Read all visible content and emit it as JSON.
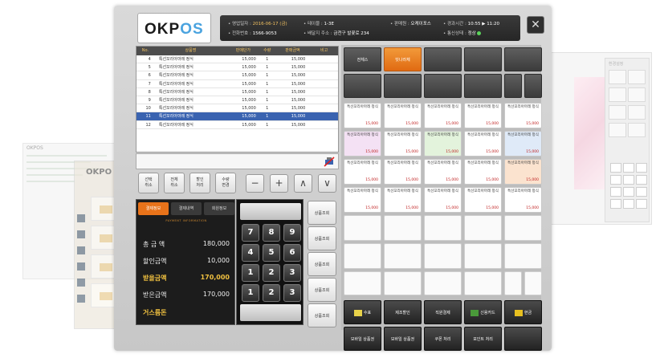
{
  "app": {
    "logo_main": "OKP",
    "logo_accent": "OS",
    "ghost_left_title": "OKPOS",
    "ghost_left2_logo": "OKPO",
    "ghost_right_title": "환경설정"
  },
  "info_bar": {
    "items": [
      {
        "label": "• 영업일자 :",
        "value": "2016-06-17 (금)"
      },
      {
        "label": "• 전화번호 :",
        "value": "1566-9053"
      },
      {
        "label": "• 테이블 :",
        "value": "1-3E"
      },
      {
        "label": "• 배달지 주소 :",
        "value": "금천구 발꽃로 234"
      },
      {
        "label": "• 판매원 :",
        "value": "오케이포스"
      },
      {
        "label": "• 경과시간 :",
        "value": "10:55"
      },
      {
        "label": "",
        "value": "11:20"
      },
      {
        "label": "• 통신상태 :",
        "value": "정상"
      }
    ]
  },
  "order_table": {
    "headers": [
      "No.",
      "상품명",
      "판매단가",
      "수량",
      "판매금액",
      "비고"
    ],
    "rows": [
      [
        "4",
        "특선꼬리아마레 정식",
        "15,000",
        "1",
        "15,000",
        ""
      ],
      [
        "5",
        "특선꼬리아마레 정식",
        "15,000",
        "1",
        "15,000",
        ""
      ],
      [
        "6",
        "특선꼬리아마레 정식",
        "15,000",
        "1",
        "15,000",
        ""
      ],
      [
        "7",
        "특선꼬리아마레 정식",
        "15,000",
        "1",
        "15,000",
        ""
      ],
      [
        "8",
        "특선꼬리아마레 정식",
        "15,000",
        "1",
        "15,000",
        ""
      ],
      [
        "9",
        "특선꼬리아마레 정식",
        "15,000",
        "1",
        "15,000",
        ""
      ],
      [
        "10",
        "특선꼬리아마레 정식",
        "15,000",
        "1",
        "15,000",
        ""
      ],
      [
        "11",
        "특선꼬리아마레 정식",
        "15,000",
        "1",
        "15,000",
        ""
      ],
      [
        "12",
        "특선꼬리아마레 정식",
        "15,000",
        "1",
        "15,000",
        ""
      ]
    ],
    "selected_index": 7
  },
  "function_buttons": [
    {
      "label": "선택\n취소"
    },
    {
      "label": "전체\n취소"
    },
    {
      "label": "할인\n처리"
    },
    {
      "label": "수량\n변경"
    }
  ],
  "step_buttons": {
    "minus": "−",
    "plus": "+",
    "up": "∧",
    "down": "∨"
  },
  "payment": {
    "tabs": [
      "결제정보",
      "결제내역",
      "회원정보"
    ],
    "subtitle": "PAYMENT INFORMATION",
    "rows": [
      {
        "label": "총 금 액",
        "value": "180,000"
      },
      {
        "label": "할인금액",
        "value": "10,000"
      },
      {
        "label": "받을금액",
        "value": "170,000"
      },
      {
        "label": "받은금액",
        "value": "170,000"
      },
      {
        "label": "거스름돈",
        "value": ""
      }
    ]
  },
  "keypad": {
    "keys": [
      "7",
      "8",
      "9",
      "4",
      "5",
      "6",
      "1",
      "2",
      "3",
      "1",
      "2",
      "3"
    ]
  },
  "side_buttons": [
    "상품조회",
    "상품조회",
    "상품조회",
    "상품조회",
    "상품조회"
  ],
  "grid": {
    "top_tabs": [
      "전체스",
      "빗나라체"
    ],
    "product_name": "특선꼬리아마레 정식",
    "product_price": "15,000",
    "actions_row1": [
      "수표",
      "제조할인",
      "직원결제",
      "신용카드",
      "현금"
    ],
    "actions_row2": [
      "모바일 상품권",
      "모바일 상품권",
      "쿠폰 처리",
      "포인트 처리"
    ]
  }
}
